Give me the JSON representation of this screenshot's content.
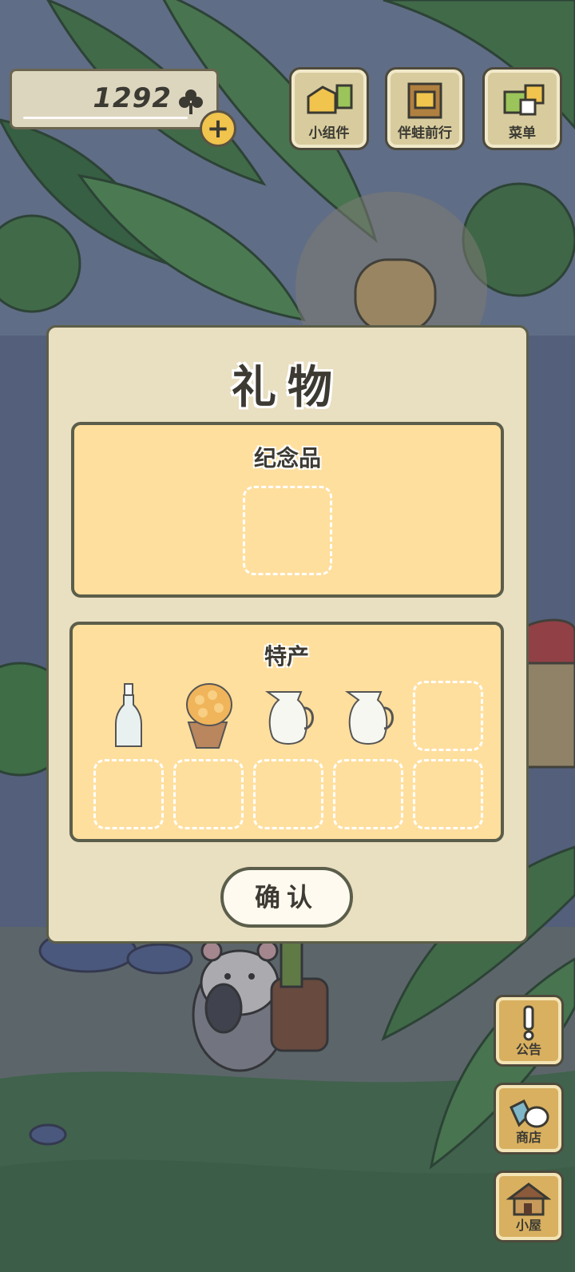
{
  "hud": {
    "clover_count": "1292",
    "add_clover": "+"
  },
  "top_buttons": [
    {
      "label": "小组件",
      "icon": "widget-icon"
    },
    {
      "label": "伴蛙前行",
      "icon": "photo-book-icon"
    },
    {
      "label": "菜单",
      "icon": "menu-cards-icon"
    }
  ],
  "side_buttons": [
    {
      "label": "公告",
      "icon": "exclamation-icon"
    },
    {
      "label": "商店",
      "icon": "shop-bags-icon"
    },
    {
      "label": "小屋",
      "icon": "house-icon"
    }
  ],
  "dialog": {
    "title": "礼物",
    "souvenir_label": "纪念品",
    "specialty_label": "特产",
    "specialty_items": [
      {
        "name": "bottle-icon"
      },
      {
        "name": "corn-snack-icon"
      },
      {
        "name": "milk-jug-icon"
      },
      {
        "name": "milk-jug-icon"
      }
    ],
    "empty_slots": 6,
    "confirm_label": "确认"
  },
  "colors": {
    "dialog_bg": "#e9dfc1",
    "panel_bg": "#ffdf9e",
    "border": "#5b5e4a",
    "dim_overlay": "rgba(40,45,70,0.35)"
  }
}
